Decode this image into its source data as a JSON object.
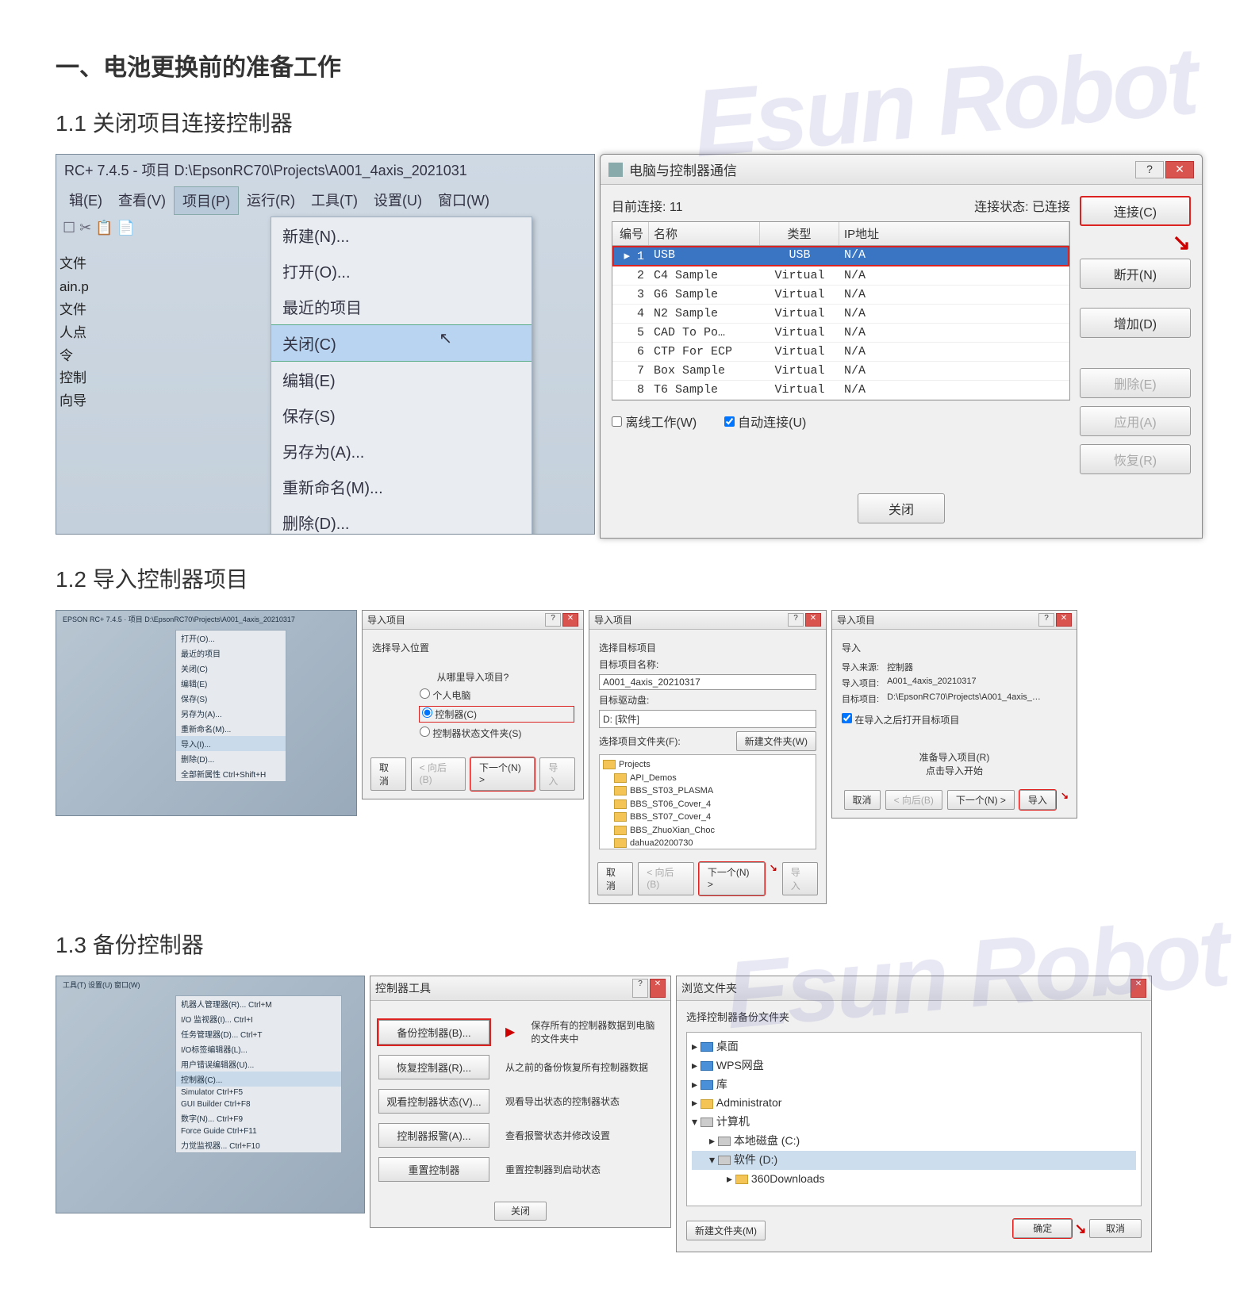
{
  "watermark": "Esun Robot",
  "section_main": "一、电池更换前的准备工作",
  "s11": {
    "title": "1.1 关闭项目连接控制器",
    "app_title": "RC+ 7.4.5 - 项目 D:\\EpsonRC70\\Projects\\A001_4axis_2021031",
    "menubar": [
      "辑(E)",
      "查看(V)",
      "项目(P)",
      "运行(R)",
      "工具(T)",
      "设置(U)",
      "窗口(W)"
    ],
    "dropdown": [
      "新建(N)...",
      "打开(O)...",
      "最近的项目",
      "关闭(C)",
      "编辑(E)",
      "保存(S)",
      "另存为(A)...",
      "重新命名(M)...",
      "删除(D)..."
    ],
    "tree": [
      "文件",
      "ain.p",
      "文件",
      "人点",
      "令",
      "控制",
      "向导"
    ],
    "dlg_title": "电脑与控制器通信",
    "status_left": "目前连接: 11",
    "status_right": "连接状态: 已连接",
    "columns": [
      "编号",
      "名称",
      "类型",
      "IP地址"
    ],
    "rows": [
      {
        "n": "1",
        "name": "USB",
        "type": "USB",
        "ip": "N/A",
        "sel": true
      },
      {
        "n": "2",
        "name": "C4 Sample",
        "type": "Virtual",
        "ip": "N/A"
      },
      {
        "n": "3",
        "name": "G6 Sample",
        "type": "Virtual",
        "ip": "N/A"
      },
      {
        "n": "4",
        "name": "N2 Sample",
        "type": "Virtual",
        "ip": "N/A"
      },
      {
        "n": "5",
        "name": "CAD To Po…",
        "type": "Virtual",
        "ip": "N/A"
      },
      {
        "n": "6",
        "name": "CTP For ECP",
        "type": "Virtual",
        "ip": "N/A"
      },
      {
        "n": "7",
        "name": "Box Sample",
        "type": "Virtual",
        "ip": "N/A"
      },
      {
        "n": "8",
        "name": "T6 Sample",
        "type": "Virtual",
        "ip": "N/A"
      }
    ],
    "chk_offline": "离线工作(W)",
    "chk_auto": "自动连接(U)",
    "btns": [
      "连接(C)",
      "断开(N)",
      "增加(D)",
      "删除(E)",
      "应用(A)",
      "恢复(R)"
    ],
    "close_btn": "关闭"
  },
  "s12": {
    "title": "1.2 导入控制器项目",
    "thumb_menu": [
      "打开(O)...",
      "最近的项目",
      "关闭(C)",
      "编辑(E)",
      "保存(S)",
      "另存为(A)...",
      "重新命名(M)...",
      "导入(I)...",
      "删除(D)...",
      "全部新属性 Ctrl+Shift+H"
    ],
    "d1": {
      "title": "导入项目",
      "sub": "选择导入位置",
      "q": "从哪里导入项目?",
      "opts": [
        "个人电脑",
        "控制器(C)",
        "控制器状态文件夹(S)"
      ],
      "btns": [
        "取消",
        "< 向后(B)",
        "下一个(N) >",
        "导入"
      ]
    },
    "d2": {
      "title": "导入项目",
      "sub": "选择目标项目",
      "lbl_name": "目标项目名称:",
      "val_name": "A001_4axis_20210317",
      "lbl_drive": "目标驱动盘:",
      "val_drive": "D: [软件]",
      "lbl_folder": "选择项目文件夹(F):",
      "newfolder": "新建文件夹(W)",
      "tree": [
        "Projects",
        "API_Demos",
        "BBS_ST03_PLASMA",
        "BBS_ST06_Cover_4",
        "BBS_ST07_Cover_4",
        "BBS_ZhuoXian_Choc",
        "dahua20200730"
      ],
      "btns": [
        "取消",
        "< 向后(B)",
        "下一个(N) >",
        "导入"
      ]
    },
    "d3": {
      "title": "导入项目",
      "sub": "导入",
      "lbl_src": "导入来源:",
      "val_src": "控制器",
      "lbl_proj": "导入项目:",
      "val_proj": "A001_4axis_20210317",
      "lbl_target": "目标项目:",
      "val_target": "D:\\EpsonRC70\\Projects\\A001_4axis_…",
      "chk": "在导入之后打开目标项目",
      "ready1": "准备导入项目(R)",
      "ready2": "点击导入开始",
      "btns": [
        "取消",
        "< 向后(B)",
        "下一个(N) >",
        "导入"
      ]
    }
  },
  "s13": {
    "title": "1.3 备份控制器",
    "thumb_menu_top": [
      "工具(T)",
      "设置(U)",
      "窗口(W)"
    ],
    "thumb_menu": [
      "机器人管理器(R)...  Ctrl+M",
      "I/O 监视器(I)...  Ctrl+I",
      "任务管理器(D)...  Ctrl+T",
      "I/O标签编辑器(L)...",
      "用户错误编辑器(U)...",
      "控制器(C)...",
      "Simulator  Ctrl+F5",
      "GUI Builder  Ctrl+F8",
      "数字(N)...  Ctrl+F9",
      "Force Guide  Ctrl+F11",
      "力觉监视器...  Ctrl+F10"
    ],
    "ct": {
      "title": "控制器工具",
      "rows": [
        {
          "b": "备份控制器(B)...",
          "d": "保存所有的控制器数据到电脑的文件夹中",
          "hl": true
        },
        {
          "b": "恢复控制器(R)...",
          "d": "从之前的备份恢复所有控制器数据"
        },
        {
          "b": "观看控制器状态(V)...",
          "d": "观看导出状态的控制器状态"
        },
        {
          "b": "控制器报警(A)...",
          "d": "查看报警状态并修改设置"
        },
        {
          "b": "重置控制器",
          "d": "重置控制器到启动状态"
        }
      ],
      "close": "关闭"
    },
    "browse": {
      "title": "浏览文件夹",
      "sub": "选择控制器备份文件夹",
      "tree": [
        {
          "t": "桌面",
          "ind": 0,
          "ic": "blue"
        },
        {
          "t": "WPS网盘",
          "ind": 0,
          "ic": "blue"
        },
        {
          "t": "库",
          "ind": 0,
          "ic": "blue"
        },
        {
          "t": "Administrator",
          "ind": 0,
          "ic": ""
        },
        {
          "t": "计算机",
          "ind": 0,
          "ic": "drive",
          "open": true
        },
        {
          "t": "本地磁盘 (C:)",
          "ind": 1,
          "ic": "drive"
        },
        {
          "t": "软件 (D:)",
          "ind": 1,
          "ic": "drive",
          "open": true,
          "sel": true
        },
        {
          "t": "360Downloads",
          "ind": 2,
          "ic": ""
        }
      ],
      "newfolder": "新建文件夹(M)",
      "ok": "确定",
      "cancel": "取消"
    }
  }
}
